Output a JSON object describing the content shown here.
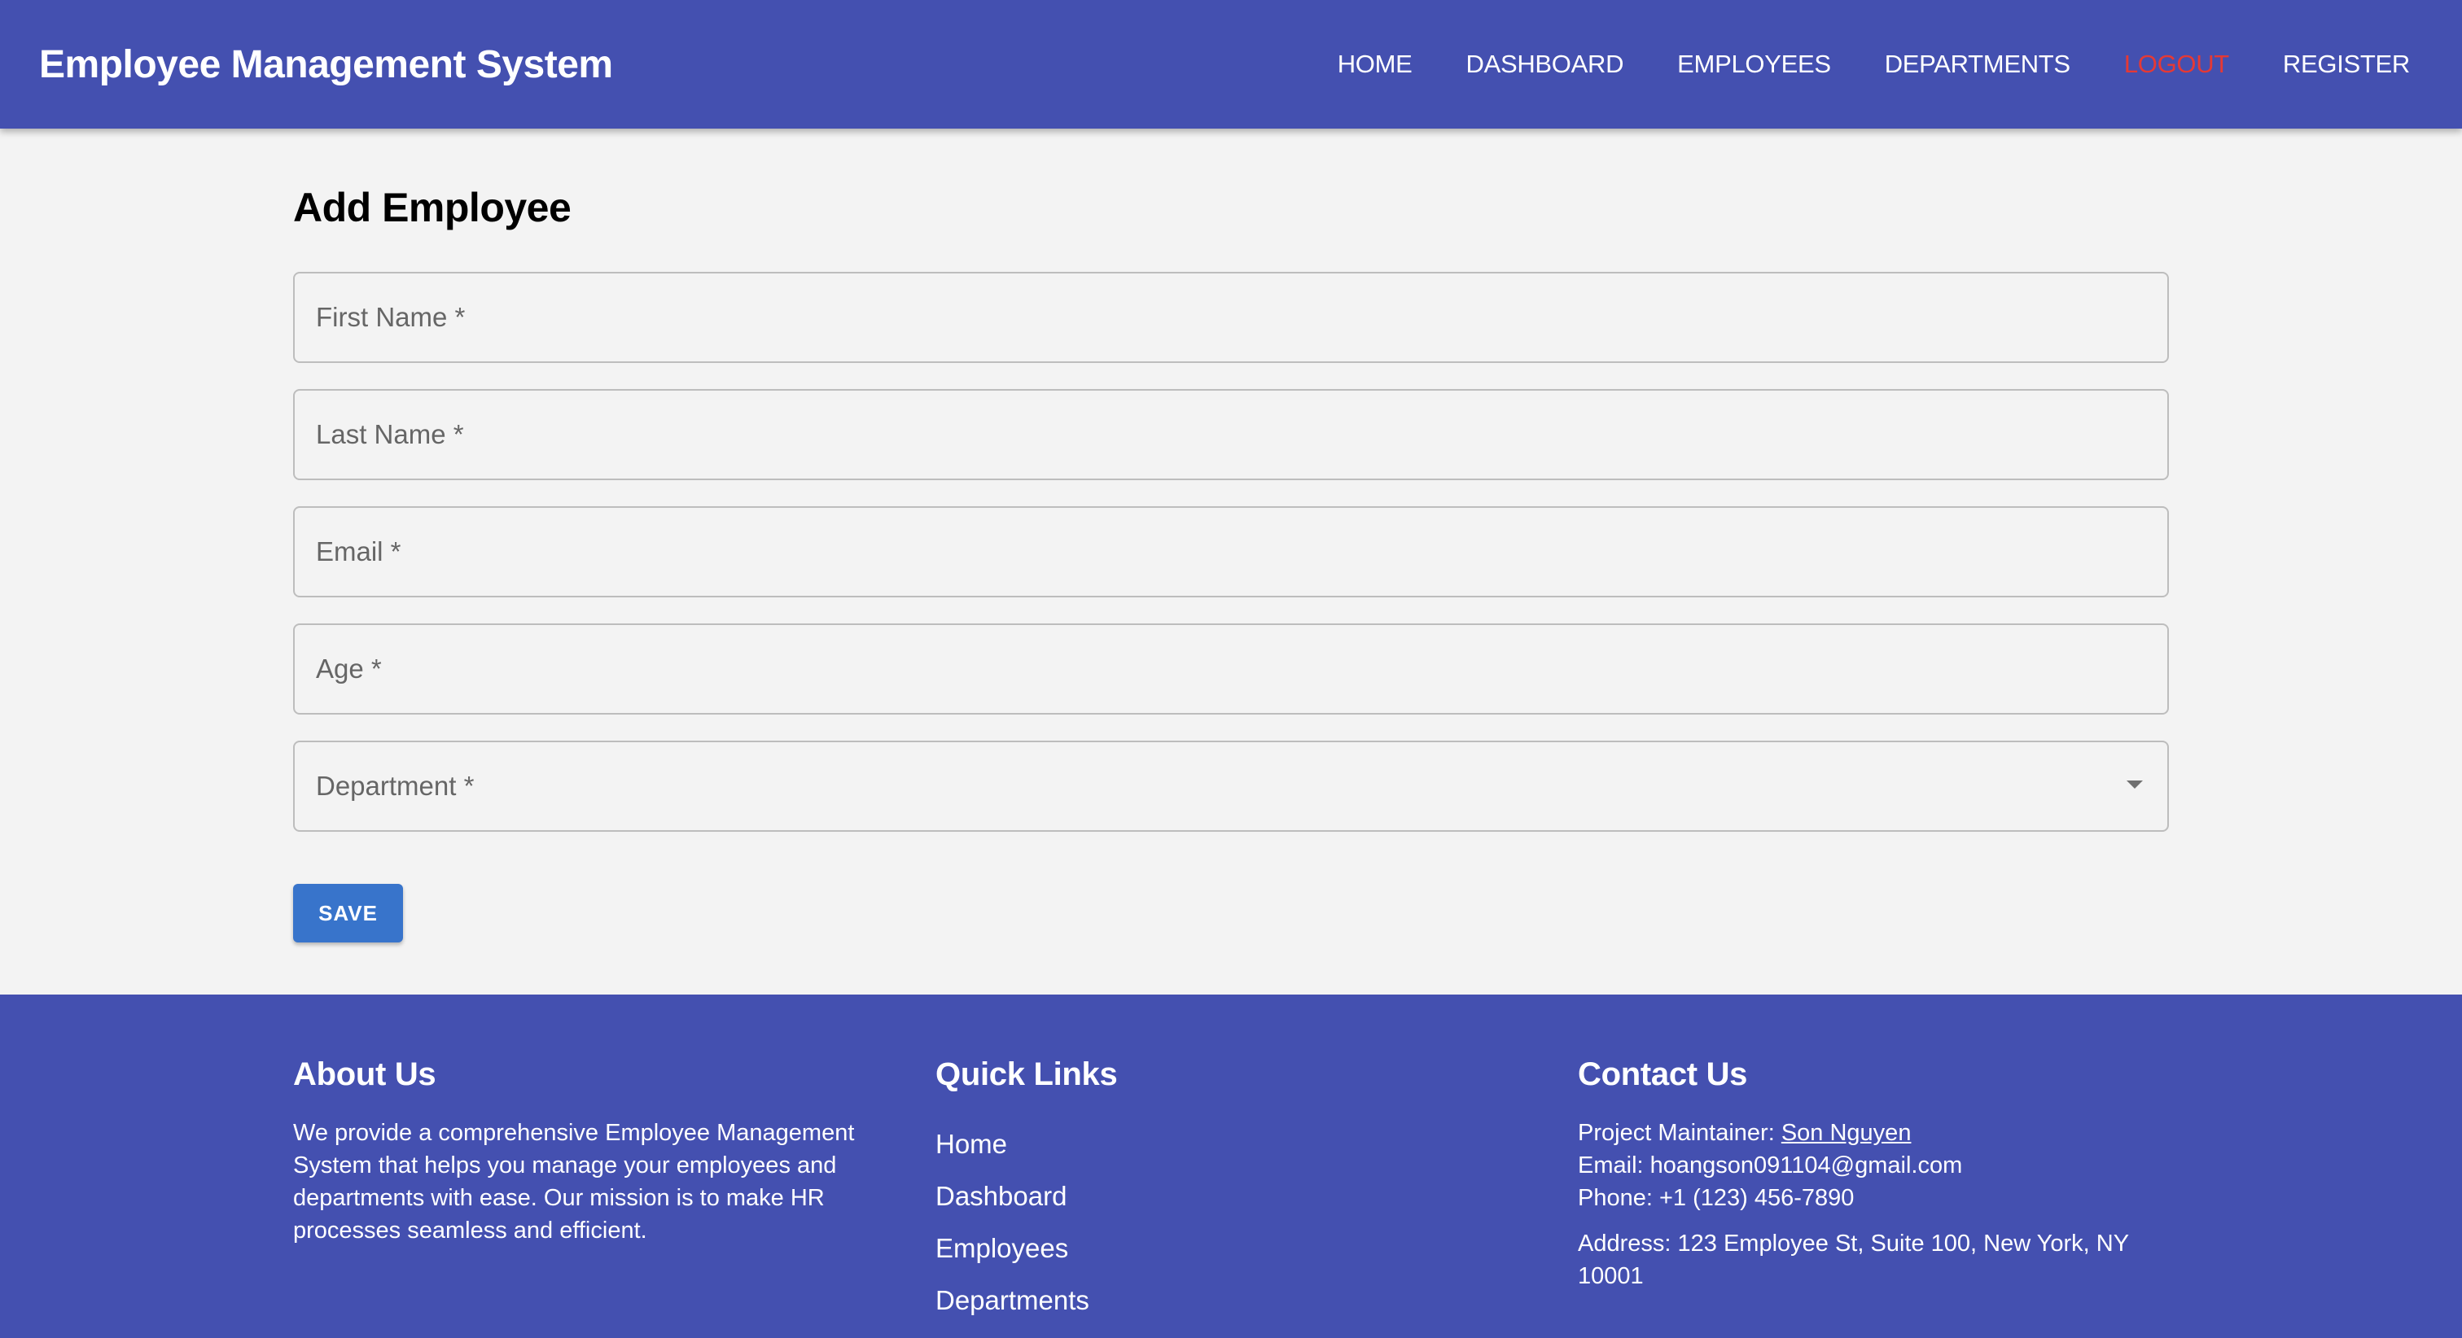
{
  "header": {
    "title": "Employee Management System",
    "nav": [
      {
        "label": "HOME"
      },
      {
        "label": "DASHBOARD"
      },
      {
        "label": "EMPLOYEES"
      },
      {
        "label": "DEPARTMENTS"
      },
      {
        "label": "LOGOUT"
      },
      {
        "label": "REGISTER"
      }
    ]
  },
  "form": {
    "title": "Add Employee",
    "fields": [
      {
        "label": "First Name *",
        "value": ""
      },
      {
        "label": "Last Name *",
        "value": ""
      },
      {
        "label": "Email *",
        "value": ""
      },
      {
        "label": "Age *",
        "value": ""
      },
      {
        "label": "Department *",
        "value": ""
      }
    ],
    "save_label": "SAVE"
  },
  "footer": {
    "about": {
      "title": "About Us",
      "text": "We provide a comprehensive Employee Management System that helps you manage your employees and departments with ease. Our mission is to make HR processes seamless and efficient."
    },
    "quick_links": {
      "title": "Quick Links",
      "items": [
        {
          "label": "Home"
        },
        {
          "label": "Dashboard"
        },
        {
          "label": "Employees"
        },
        {
          "label": "Departments"
        }
      ]
    },
    "contact": {
      "title": "Contact Us",
      "maintainer_prefix": "Project Maintainer: ",
      "maintainer_name": "Son Nguyen",
      "email": "Email: hoangson091104@gmail.com",
      "phone": "Phone: +1 (123) 456-7890",
      "address": "Address: 123 Employee St, Suite 100, New York, NY 10001"
    }
  },
  "colors": {
    "primary": "#4450b0",
    "button": "#3874cb",
    "logout": "#e53935",
    "background": "#f3f3f3"
  }
}
